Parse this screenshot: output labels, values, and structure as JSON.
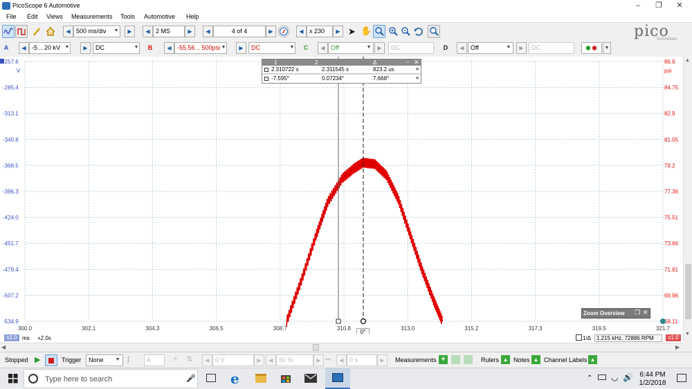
{
  "window": {
    "title": "PicoScope 6 Automotive"
  },
  "menu": [
    "File",
    "Edit",
    "Views",
    "Measurements",
    "Tools",
    "Automotive",
    "Help"
  ],
  "toolbar": {
    "timebase": "500 ms/div",
    "samples": "2 MS",
    "buffer": "4 of 4",
    "zoom": "x 230"
  },
  "channels": {
    "a": {
      "letter": "A",
      "range": "-5 .. 20 kV",
      "coupling": "DC",
      "color": "#3a4fc4"
    },
    "b": {
      "letter": "B",
      "range": "-55.56 .. 500psi",
      "coupling": "DC",
      "color": "#e01010"
    },
    "c": {
      "letter": "C",
      "range": "Off",
      "coupling": "DC",
      "color": "#3a9a3a"
    },
    "d": {
      "letter": "D",
      "range": "Off",
      "coupling": "DC",
      "color": "#222222"
    }
  },
  "logo": {
    "name": "pico",
    "sub": "Technology"
  },
  "scope": {
    "left_unit": "V",
    "right_unit": "psi",
    "left_ticks": [
      "-257.6",
      "-285.4",
      "-313.1",
      "-340.8",
      "-368.5",
      "-396.3",
      "-424.0",
      "-451.7",
      "-479.4",
      "-507.2",
      "-534.9"
    ],
    "right_ticks": [
      "86.6",
      "84.75",
      "82.9",
      "81.05",
      "79.2",
      "77.36",
      "75.51",
      "73.66",
      "71.81",
      "69.96",
      "68.11"
    ],
    "x_ticks": [
      "300.0",
      "302.1",
      "304.3",
      "306.5",
      "308.7",
      "310.8",
      "313.0",
      "315.2",
      "317.3",
      "319.5",
      "321.7"
    ],
    "x_unit": "ms",
    "x_offset": "+2.0s",
    "x_badge": "x1.0",
    "right_badge": "x1.0",
    "cursor_label": "0°",
    "rpm_readout": "1.215 kHz, 72886 RPM",
    "rpm_badge": "1/Δ"
  },
  "chart_data": {
    "type": "line",
    "series": [
      {
        "color": "#e00000",
        "axis": "right",
        "x": [
          308.9,
          309.4,
          309.9,
          310.3,
          310.8,
          311.2,
          311.5,
          311.9,
          312.3,
          312.7,
          313.1,
          313.5,
          313.9,
          314.2
        ],
        "y": [
          68.1,
          71.0,
          74.2,
          76.6,
          78.3,
          79.0,
          79.4,
          79.3,
          78.5,
          76.8,
          74.3,
          71.8,
          69.6,
          68.1
        ]
      }
    ],
    "xlim": [
      300.0,
      321.7
    ],
    "ylim_left": [
      -534.9,
      -257.6
    ],
    "ylim_right": [
      68.11,
      86.6
    ],
    "grid": true
  },
  "measure_table": {
    "headers": [
      "1",
      "2",
      "Δ"
    ],
    "rows": [
      [
        "2.310722 s",
        "2.311545 s",
        "823.2 us"
      ],
      [
        "-7.595°",
        "0.07234°",
        "7.668°"
      ]
    ]
  },
  "zoom_overview": {
    "label": "Zoom Overview"
  },
  "status": {
    "stopped": "Stopped",
    "trigger": "Trigger",
    "trigger_mode": "None",
    "trigger_channel": "A",
    "level": "0 V",
    "percent": "50 %",
    "delay": "0 s",
    "measurements": "Measurements",
    "rulers": "Rulers",
    "notes": "Notes",
    "channel_labels": "Channel Labels"
  },
  "taskbar": {
    "search_placeholder": "Type here to search",
    "time": "6:44 PM",
    "date": "1/2/2018"
  }
}
